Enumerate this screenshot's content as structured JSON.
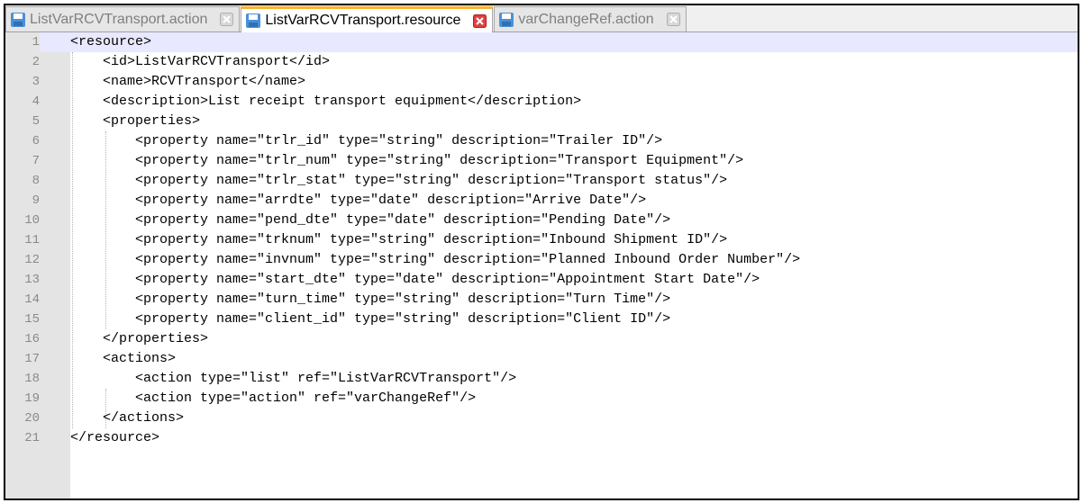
{
  "tabs": [
    {
      "label": "ListVarRCVTransport.action",
      "active": false
    },
    {
      "label": "ListVarRCVTransport.resource",
      "active": true
    },
    {
      "label": "varChangeRef.action",
      "active": false
    }
  ],
  "colors": {
    "active_tab_accent": "#fab432",
    "close_active": "#e04040",
    "close_inactive": "#b0b0b0",
    "doc_icon": "#4a90d9",
    "current_line": "#e8e8ff"
  },
  "editor": {
    "current_line": 1,
    "lines": [
      {
        "num": "1",
        "text": "<resource>"
      },
      {
        "num": "2",
        "text": "    <id>ListVarRCVTransport</id>"
      },
      {
        "num": "3",
        "text": "    <name>RCVTransport</name>"
      },
      {
        "num": "4",
        "text": "    <description>List receipt transport equipment</description>"
      },
      {
        "num": "5",
        "text": "    <properties>"
      },
      {
        "num": "6",
        "text": "        <property name=\"trlr_id\" type=\"string\" description=\"Trailer ID\"/>"
      },
      {
        "num": "7",
        "text": "        <property name=\"trlr_num\" type=\"string\" description=\"Transport Equipment\"/>"
      },
      {
        "num": "8",
        "text": "        <property name=\"trlr_stat\" type=\"string\" description=\"Transport status\"/>"
      },
      {
        "num": "9",
        "text": "        <property name=\"arrdte\" type=\"date\" description=\"Arrive Date\"/>"
      },
      {
        "num": "10",
        "text": "        <property name=\"pend_dte\" type=\"date\" description=\"Pending Date\"/>"
      },
      {
        "num": "11",
        "text": "        <property name=\"trknum\" type=\"string\" description=\"Inbound Shipment ID\"/>"
      },
      {
        "num": "12",
        "text": "        <property name=\"invnum\" type=\"string\" description=\"Planned Inbound Order Number\"/>"
      },
      {
        "num": "13",
        "text": "        <property name=\"start_dte\" type=\"date\" description=\"Appointment Start Date\"/>"
      },
      {
        "num": "14",
        "text": "        <property name=\"turn_time\" type=\"string\" description=\"Turn Time\"/>"
      },
      {
        "num": "15",
        "text": "        <property name=\"client_id\" type=\"string\" description=\"Client ID\"/>"
      },
      {
        "num": "16",
        "text": "    </properties>"
      },
      {
        "num": "17",
        "text": "    <actions>"
      },
      {
        "num": "18",
        "text": "        <action type=\"list\" ref=\"ListVarRCVTransport\"/>"
      },
      {
        "num": "19",
        "text": "        <action type=\"action\" ref=\"varChangeRef\"/>"
      },
      {
        "num": "20",
        "text": "    </actions>"
      },
      {
        "num": "21",
        "text": "</resource>"
      }
    ]
  }
}
